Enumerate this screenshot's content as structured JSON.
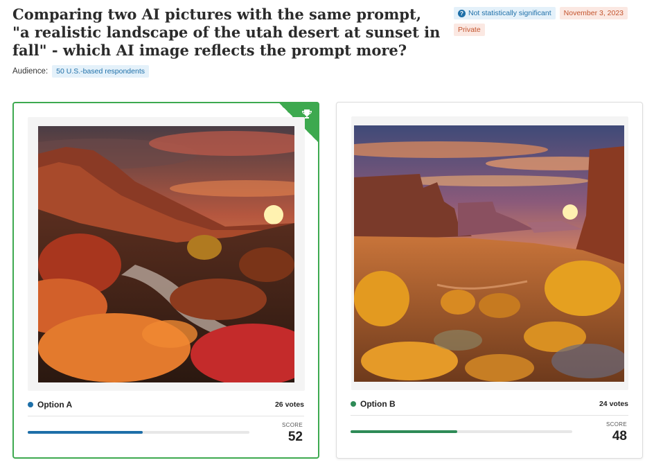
{
  "title": "Comparing two AI pictures with the same prompt, \"a realistic landscape of the utah desert at sunset in fall\" - which AI image reflects the prompt more?",
  "badges": {
    "significance": "Not statistically significant",
    "date": "November 3, 2023",
    "visibility": "Private"
  },
  "audience": {
    "label": "Audience:",
    "value": "50 U.S.-based respondents"
  },
  "options": [
    {
      "name": "Option A",
      "votes": "26 votes",
      "score_label": "SCORE",
      "score": "52",
      "score_fraction": 0.52,
      "color": "#1e6fa8",
      "winner": true,
      "image": "desert-canyon-river-sunset-image"
    },
    {
      "name": "Option B",
      "votes": "24 votes",
      "score_label": "SCORE",
      "score": "48",
      "score_fraction": 0.48,
      "color": "#2e8b57",
      "winner": false,
      "image": "desert-mesa-sunset-image"
    }
  ],
  "colors": {
    "winner_border": "#3da94f",
    "info_badge_bg": "#e4f1fa",
    "info_badge_text": "#1e6fa8",
    "warn_badge_bg": "#fbe8e2",
    "warn_badge_text": "#c3542d"
  },
  "icons": {
    "significance": "question-circle-icon",
    "winner": "trophy-icon"
  }
}
